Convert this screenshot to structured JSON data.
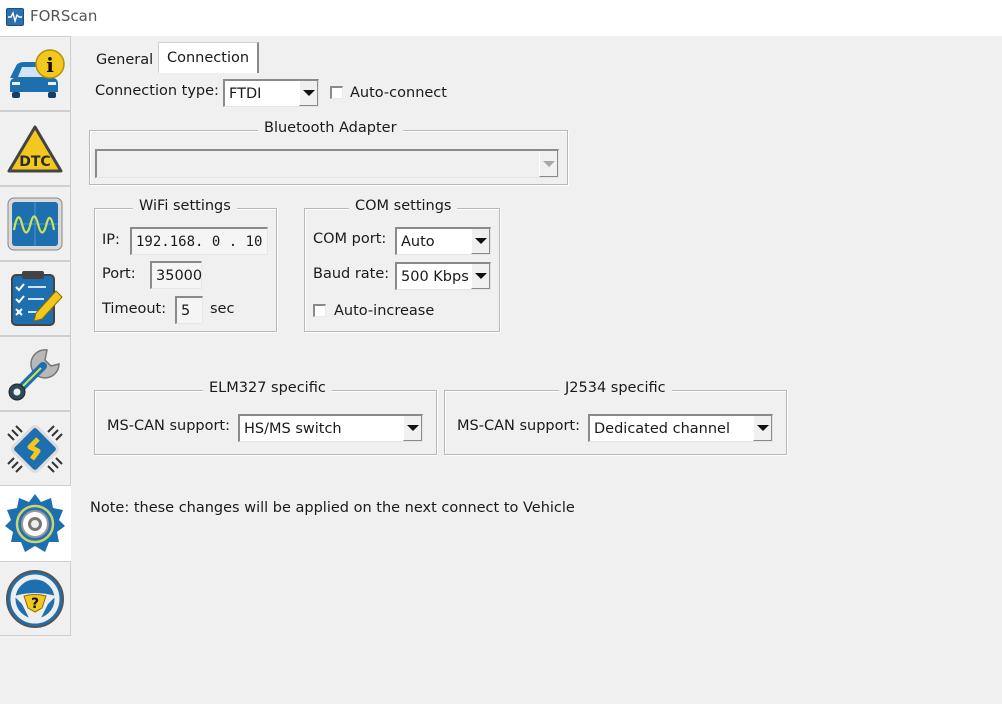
{
  "window": {
    "title": "FORScan",
    "icon": "pulse-icon"
  },
  "sidebar": {
    "items": [
      {
        "name": "vehicle-info",
        "icon": "car-info-icon",
        "active": false
      },
      {
        "name": "dtc",
        "icon": "dtc-warning-icon",
        "active": false
      },
      {
        "name": "oscilloscope",
        "icon": "oscilloscope-icon",
        "active": false
      },
      {
        "name": "tests",
        "icon": "checklist-icon",
        "active": false
      },
      {
        "name": "service",
        "icon": "wrench-icon",
        "active": false
      },
      {
        "name": "configuration",
        "icon": "chip-icon",
        "active": false
      },
      {
        "name": "settings",
        "icon": "gear-icon",
        "active": true
      },
      {
        "name": "help",
        "icon": "steering-help-icon",
        "active": false
      }
    ]
  },
  "tabs": [
    {
      "label": "General",
      "active": false
    },
    {
      "label": "Connection",
      "active": true
    }
  ],
  "connection": {
    "type_label": "Connection type:",
    "type_value": "FTDI",
    "auto_connect_label": "Auto-connect",
    "auto_connect_checked": false
  },
  "bluetooth": {
    "title": "Bluetooth Adapter",
    "value": "",
    "disabled": true
  },
  "wifi": {
    "title": "WiFi settings",
    "ip_label": "IP:",
    "ip_value": "192.168. 0 . 10",
    "port_label": "Port:",
    "port_value": "35000",
    "timeout_label": "Timeout:",
    "timeout_value": "5",
    "timeout_unit": "sec"
  },
  "com": {
    "title": "COM settings",
    "port_label": "COM port:",
    "port_value": "Auto",
    "baud_label": "Baud rate:",
    "baud_value": "500 Kbps",
    "auto_increase_label": "Auto-increase",
    "auto_increase_checked": false
  },
  "elm327": {
    "title": "ELM327 specific",
    "mscan_label": "MS-CAN support:",
    "mscan_value": "HS/MS switch"
  },
  "j2534": {
    "title": "J2534 specific",
    "mscan_label": "MS-CAN support:",
    "mscan_value": "Dedicated channel"
  },
  "note": "Note: these changes will be applied on the next connect to Vehicle",
  "colors": {
    "accent_blue": "#1d6fb0",
    "icon_yellow": "#f2c81e",
    "background": "#f0f0f0"
  }
}
